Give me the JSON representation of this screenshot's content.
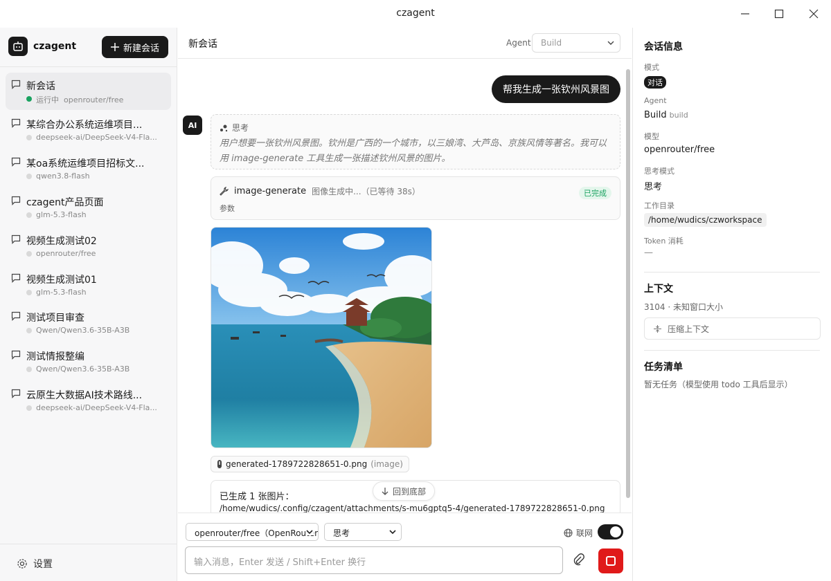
{
  "window": {
    "title": "czagent"
  },
  "sidebar": {
    "brand": "czagent",
    "new_chat_label": "新建会话",
    "sessions": [
      {
        "title": "新会话",
        "status": "运行中",
        "model": "openrouter/free",
        "active": true
      },
      {
        "title": "某综合办公系统运维项目...",
        "model": "deepseek-ai/DeepSeek-V4-Fla..."
      },
      {
        "title": "某oa系统运维项目招标文...",
        "model": "qwen3.8-flash"
      },
      {
        "title": "czagent产品页面",
        "model": "glm-5.3-flash"
      },
      {
        "title": "视频生成测试02",
        "model": "openrouter/free"
      },
      {
        "title": "视频生成测试01",
        "model": "glm-5.3-flash"
      },
      {
        "title": "测试项目审查",
        "model": "Qwen/Qwen3.6-35B-A3B"
      },
      {
        "title": "测试情报整编",
        "model": "Qwen/Qwen3.6-35B-A3B"
      },
      {
        "title": "云原生大数据AI技术路线...",
        "model": "deepseek-ai/DeepSeek-V4-Fla..."
      }
    ],
    "settings_label": "设置"
  },
  "main": {
    "title": "新会话",
    "agent_label": "Agent",
    "agent_value": "Build",
    "user_message": "帮我生成一张钦州风景图",
    "ai_avatar": "AI",
    "thinking": {
      "label": "思考",
      "text": "用户想要一张钦州风景图。钦州是广西的一个城市，以三娘湾、大芦岛、京族风情等著名。我可以用 image-generate 工具生成一张描述钦州风景的图片。"
    },
    "tool": {
      "name": "image-generate",
      "status": "图像生成中...（已等待 38s）",
      "badge": "已完成",
      "args_label": "参数"
    },
    "file": {
      "name": "generated-1789722828651-0.png",
      "type": "(image)"
    },
    "result": {
      "line1": "已生成 1 张图片：",
      "line2": "/home/wudics/.config/czagent/attachments/s-mu6gptq5-4/generated-1789722828651-0.png"
    },
    "back_to_bottom": "回到底部",
    "composer": {
      "model": "openrouter/free（OpenRouter）",
      "thinking_mode": "思考",
      "net_label": "联网",
      "net_enabled": true,
      "placeholder": "输入消息，Enter 发送 / Shift+Enter 换行"
    }
  },
  "panel": {
    "session_info_title": "会话信息",
    "mode_label": "模式",
    "mode_value": "对话",
    "agent_label": "Agent",
    "agent_value": "Build",
    "agent_id": "build",
    "model_label": "模型",
    "model_value": "openrouter/free",
    "think_label": "思考模式",
    "think_value": "思考",
    "workdir_label": "工作目录",
    "workdir_value": "/home/wudics/czworkspace",
    "token_label": "Token 消耗",
    "token_value": "—",
    "context_title": "上下文",
    "context_info": "3104 · 未知窗口大小",
    "compress_label": "压缩上下文",
    "tasks_title": "任务清单",
    "tasks_empty": "暂无任务（模型使用 todo 工具后显示）"
  },
  "colors": {
    "accent": "#1a1a1a",
    "running": "#1aa260",
    "stop": "#e01a1a",
    "done_bg": "#e4f6ec"
  }
}
